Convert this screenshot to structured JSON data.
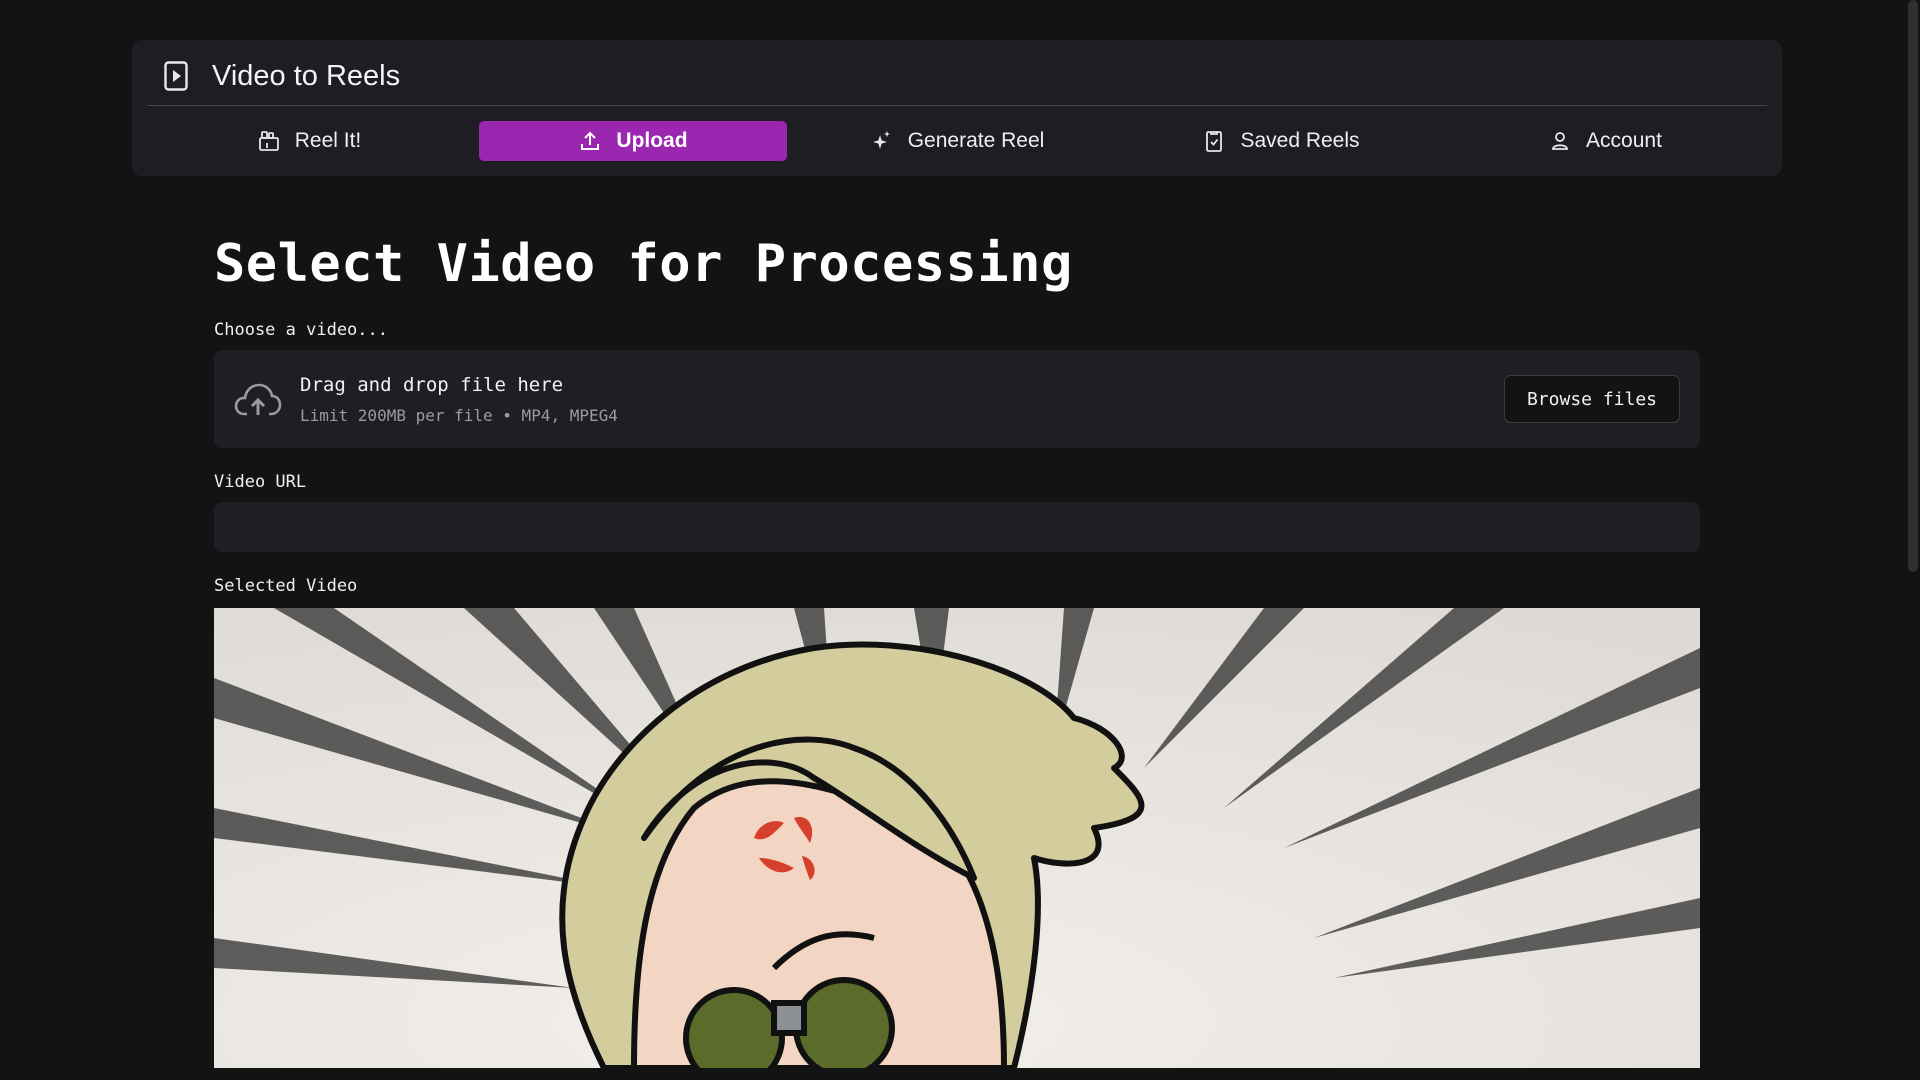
{
  "app": {
    "title": "Video to Reels",
    "icon": "play-square-icon"
  },
  "nav": {
    "items": [
      {
        "label": "Reel It!",
        "icon": "camera-icon",
        "active": false
      },
      {
        "label": "Upload",
        "icon": "upload-icon",
        "active": true
      },
      {
        "label": "Generate Reel",
        "icon": "sparkles-icon",
        "active": false
      },
      {
        "label": "Saved Reels",
        "icon": "clipboard-check-icon",
        "active": false
      },
      {
        "label": "Account",
        "icon": "user-icon",
        "active": false
      }
    ],
    "active_color": "#9b27b0"
  },
  "main": {
    "title": "Select Video for Processing",
    "uploader": {
      "label": "Choose a video...",
      "drop_title": "Drag and drop file here",
      "limit_text": "Limit 200MB per file • MP4, MPEG4",
      "browse_label": "Browse files",
      "icon": "cloud-upload-icon"
    },
    "url": {
      "label": "Video URL",
      "value": ""
    },
    "selected": {
      "label": "Selected Video"
    }
  }
}
